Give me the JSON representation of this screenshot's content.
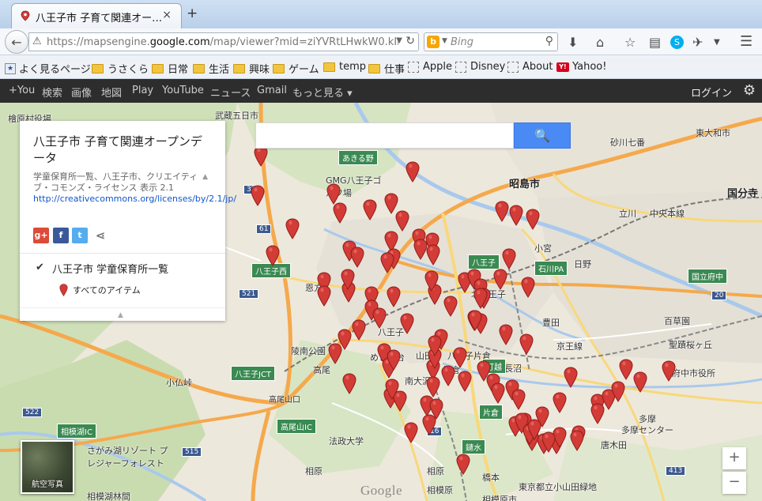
{
  "browser": {
    "tab_title": "八王子市 子育て関連オー…",
    "tab_close": "×",
    "new_tab": "+",
    "url_prefix": "https://mapsengine.",
    "url_domain": "google.com",
    "url_rest": "/map/viewer?mid=ziYVRtLHwkW0.kIk7r",
    "search_placeholder": "Bing"
  },
  "bookmarks": [
    {
      "label": "よく見るページ",
      "icon": "bookmark-star-icon"
    },
    {
      "label": "うさくら",
      "icon": "folder-icon"
    },
    {
      "label": "日常",
      "icon": "folder-icon"
    },
    {
      "label": "生活",
      "icon": "folder-icon"
    },
    {
      "label": "興味",
      "icon": "folder-icon"
    },
    {
      "label": "ゲーム",
      "icon": "folder-icon"
    },
    {
      "label": "temp",
      "icon": "folder-icon"
    },
    {
      "label": "仕事",
      "icon": "folder-icon"
    },
    {
      "label": "Apple",
      "icon": "dashed-box-icon"
    },
    {
      "label": "Disney",
      "icon": "dashed-box-icon"
    },
    {
      "label": "About",
      "icon": "dashed-box-icon"
    },
    {
      "label": "Yahoo!",
      "icon": "yahoo-icon"
    }
  ],
  "google_bar": {
    "items": [
      "+You",
      "検索",
      "画像",
      "地図",
      "Play",
      "YouTube",
      "ニュース",
      "Gmail",
      "もっと見る ▾"
    ],
    "login": "ログイン"
  },
  "panel": {
    "title": "八王子市 子育て関連オープンデータ",
    "description": "学童保育所一覧、八王子市、クリエイティブ・コモンズ・ライセンス 表示 2.1",
    "license_link": "http://creativecommons.org/licenses/by/2.1/jp/",
    "share_buttons": [
      "g+",
      "f",
      "t"
    ],
    "layer_name": "八王子市 学童保育所一覧",
    "all_items": "すべてのアイテム"
  },
  "map": {
    "satellite_label": "航空写真",
    "zoom_in": "+",
    "zoom_out": "−",
    "logo": "Google",
    "labels": [
      {
        "t": "武蔵五日市",
        "big": false
      },
      {
        "t": "昭島市",
        "big": true
      },
      {
        "t": "国分寺",
        "big": true
      },
      {
        "t": "八王子",
        "big": false
      },
      {
        "t": "日野",
        "big": false
      },
      {
        "t": "立川",
        "big": false
      },
      {
        "t": "多摩",
        "big": false
      },
      {
        "t": "相原",
        "big": false
      },
      {
        "t": "高尾",
        "big": false
      },
      {
        "t": "唐木田",
        "big": false
      },
      {
        "t": "恩方",
        "big": false
      },
      {
        "t": "豊田",
        "big": false
      },
      {
        "t": "百草園",
        "big": false
      },
      {
        "t": "長沼",
        "big": false
      },
      {
        "t": "小宮",
        "big": false
      },
      {
        "t": "北八王子",
        "big": false
      },
      {
        "t": "片倉",
        "big": false
      },
      {
        "t": "橋本",
        "big": false
      },
      {
        "t": "陵南公園",
        "big": false
      },
      {
        "t": "法政大学",
        "big": false
      },
      {
        "t": "さがみ湖リゾート プレジャーフォレスト",
        "big": false
      },
      {
        "t": "相模湖林間",
        "big": false
      },
      {
        "t": "小仏峠",
        "big": false
      },
      {
        "t": "檜原村役場",
        "big": false
      },
      {
        "t": "府中市役所",
        "big": false
      },
      {
        "t": "東大和市",
        "big": false
      },
      {
        "t": "砂川七番",
        "big": false
      },
      {
        "t": "中央本線",
        "big": false
      },
      {
        "t": "京王線",
        "big": false
      },
      {
        "t": "多摩センター",
        "big": false
      },
      {
        "t": "GMG八王子ゴルフ場",
        "big": false
      },
      {
        "t": "八王子片倉",
        "big": false
      },
      {
        "t": "相模原",
        "big": false
      },
      {
        "t": "南大沢",
        "big": false
      },
      {
        "t": "めじろ台",
        "big": false
      },
      {
        "t": "山田",
        "big": false
      },
      {
        "t": "東京都立小山田緑地",
        "big": false
      },
      {
        "t": "相原",
        "big": false
      },
      {
        "t": "相模原市",
        "big": false
      },
      {
        "t": "聖蹟桜ヶ丘",
        "big": false
      }
    ],
    "shields": [
      "八王子JCT",
      "高尾山口",
      "高尾山IC",
      "相模湖IC",
      "八王子",
      "石川PA",
      "国立府中",
      "あきる野",
      "八王子西",
      "打越",
      "鑓水",
      "片倉"
    ],
    "route_numbers": [
      "32",
      "61",
      "521",
      "522",
      "515",
      "413",
      "20",
      "16"
    ],
    "pin_count": 97
  }
}
